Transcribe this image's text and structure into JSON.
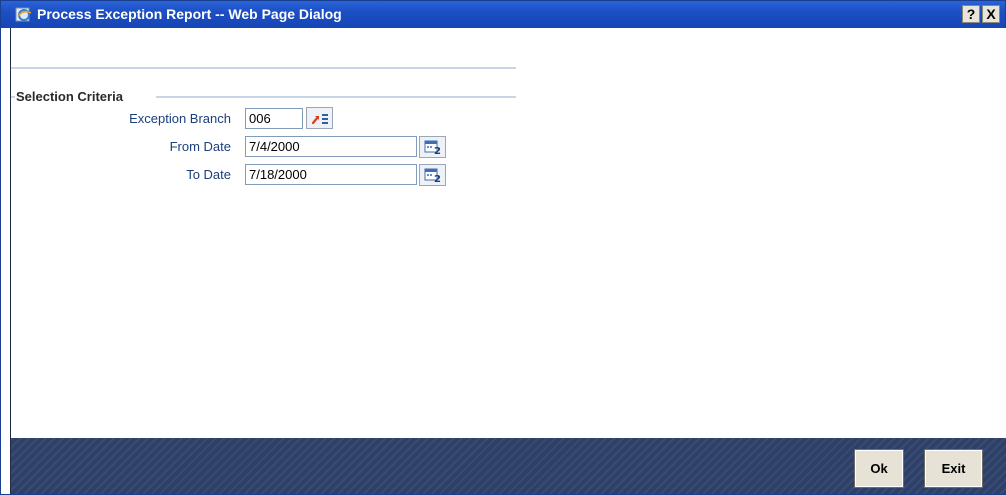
{
  "window": {
    "title": "Process Exception Report -- Web Page Dialog",
    "help_label": "?",
    "close_label": "X"
  },
  "selection_criteria": {
    "legend": "Selection Criteria",
    "exception_branch": {
      "label": "Exception Branch",
      "value": "006"
    },
    "from_date": {
      "label": "From Date",
      "value": "7/4/2000"
    },
    "to_date": {
      "label": "To Date",
      "value": "7/18/2000"
    }
  },
  "footer": {
    "ok_label": "Ok",
    "exit_label": "Exit"
  },
  "icons": {
    "app": "ie-page-icon",
    "lov": "list-of-values-icon",
    "calendar": "calendar-icon"
  },
  "colors": {
    "title_bar": "#1c4fc4",
    "footer": "#2e4068",
    "label_text": "#1a3f7a"
  }
}
